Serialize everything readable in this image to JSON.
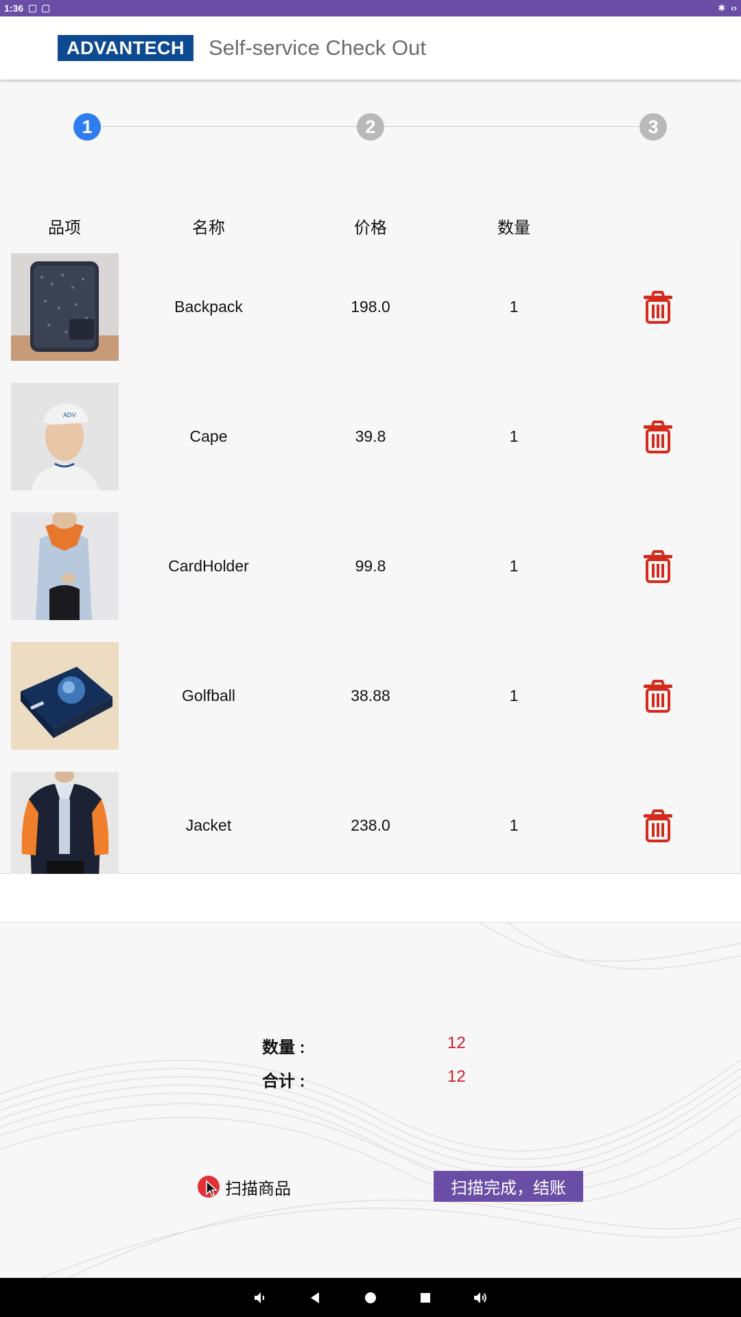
{
  "status_bar": {
    "time": "1:36"
  },
  "app": {
    "logo_text": "ADVANTECH",
    "title": "Self-service Check Out"
  },
  "stepper": {
    "steps": [
      "1",
      "2",
      "3"
    ],
    "active_step": 1,
    "colors": {
      "active": "#2f7cf0",
      "inactive": "#b9b9b9"
    }
  },
  "table": {
    "headers": {
      "item": "品项",
      "name": "名称",
      "price": "价格",
      "quantity": "数量"
    },
    "rows": [
      {
        "name": "Backpack",
        "price": "198.0",
        "quantity": "1",
        "image": "backpack"
      },
      {
        "name": "Cape",
        "price": "39.8",
        "quantity": "1",
        "image": "cap"
      },
      {
        "name": "CardHolder",
        "price": "99.8",
        "quantity": "1",
        "image": "cardholder"
      },
      {
        "name": "Golfball",
        "price": "38.88",
        "quantity": "1",
        "image": "golfball-box"
      },
      {
        "name": "Jacket",
        "price": "238.0",
        "quantity": "1",
        "image": "jacket"
      }
    ],
    "delete_icon": "trash-icon",
    "delete_color": "#d42a1c"
  },
  "summary": {
    "quantity_label": "数量 :",
    "quantity_value": "12",
    "total_label": "合计 :",
    "total_value": "12"
  },
  "actions": {
    "scan_label": "扫描商品",
    "checkout_label": "扫描完成，结账"
  },
  "colors": {
    "brand": "#6a4ea6",
    "logo_blue": "#0d4a91",
    "value_red": "#d41a24"
  }
}
